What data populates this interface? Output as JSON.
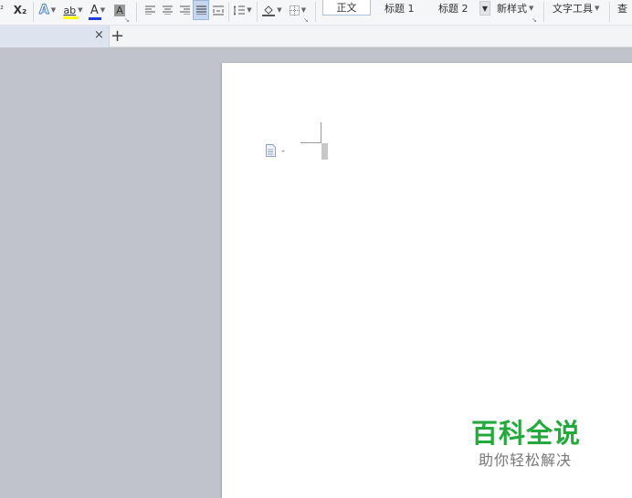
{
  "ribbon": {
    "subscript_label": "X₂",
    "text_effect_label": "A",
    "highlight_label": "ab",
    "font_color_label": "A",
    "char_shading_label": "A",
    "styles": {
      "normal": "正文",
      "heading1": "标题 1",
      "heading2": "标题 2",
      "new_style": "新样式",
      "text_tools": "文字工具",
      "find_partial": "查"
    },
    "colors": {
      "highlight_bar": "#ffff00",
      "font_color_bar": "#1d3fe0",
      "watermark_green": "#24a93c"
    }
  },
  "tabbar": {
    "close_glyph": "×",
    "add_glyph": "+"
  },
  "document": {
    "body_text": ""
  },
  "watermark": {
    "title": "百科全说",
    "subtitle": "助你轻松解决"
  }
}
